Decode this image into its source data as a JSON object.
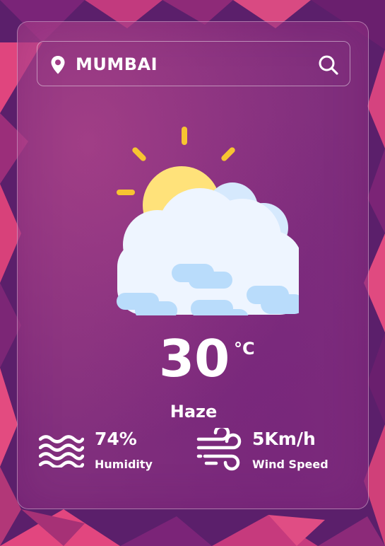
{
  "search": {
    "value": "MUMBAI",
    "placeholder": "MUMBAI"
  },
  "weather": {
    "temperature": "30",
    "unit": "°C",
    "description": "Haze",
    "icon": "partly-cloudy-sun"
  },
  "details": {
    "humidity": {
      "value": "74%",
      "label": "Humidity",
      "icon": "humidity-waves-icon"
    },
    "wind": {
      "value": "5Km/h",
      "label": "Wind Speed",
      "icon": "wind-icon"
    }
  },
  "colors": {
    "background": "#5b1f6b",
    "accent_pink": "#e0457e",
    "sun": "#ffe27a",
    "sun_rays": "#f7c431",
    "cloud": "#eef5ff",
    "cloud_shadow": "#b9dcfb",
    "text": "#ffffff"
  }
}
